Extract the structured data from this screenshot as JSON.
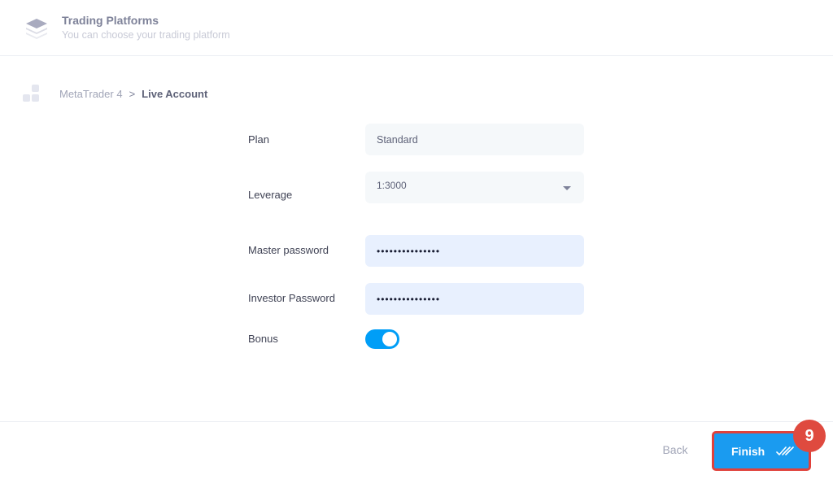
{
  "header": {
    "icon": "layers-icon",
    "title": "Trading Platforms",
    "subtitle": "You can choose your trading platform"
  },
  "breadcrumb": {
    "icon": "apps-grid-icon",
    "items": [
      "MetaTrader 4"
    ],
    "separator": ">",
    "current": "Live Account"
  },
  "form": {
    "plan": {
      "label": "Plan",
      "value": "Standard"
    },
    "leverage": {
      "label": "Leverage",
      "value": "1:3000",
      "icon": "caret-down-icon"
    },
    "master_password": {
      "label": "Master password",
      "value": "•••••••••••••••"
    },
    "investor_password": {
      "label": "Investor Password",
      "value": "•••••••••••••••"
    },
    "bonus": {
      "label": "Bonus",
      "enabled": true
    }
  },
  "footer": {
    "back_label": "Back",
    "finish_label": "Finish",
    "finish_icon": "double-check-icon",
    "step_badge": "9"
  },
  "colors": {
    "accent": "#009ef7",
    "highlight_border": "#e0413b",
    "badge": "#df4a3f"
  }
}
